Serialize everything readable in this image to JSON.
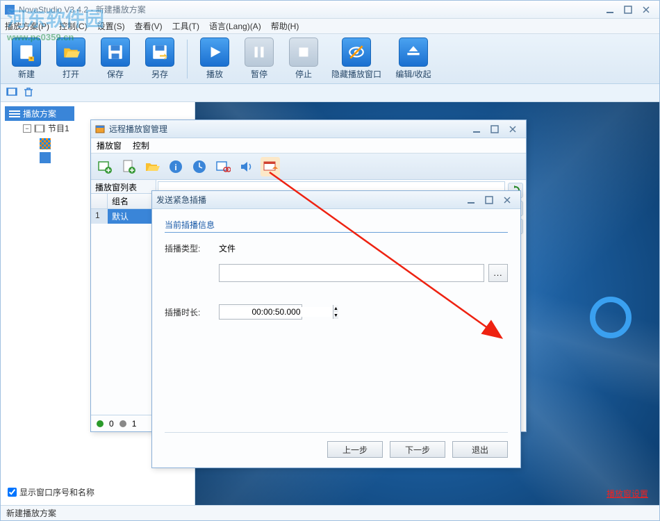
{
  "main": {
    "title": "NovaStudio V3.4.2 - 新建播放方案",
    "menu": [
      "播放方案(P)",
      "控制(C)",
      "设置(S)",
      "查看(V)",
      "工具(T)",
      "语言(Lang)(A)",
      "帮助(H)"
    ],
    "toolbar": {
      "new": "新建",
      "open": "打开",
      "save": "保存",
      "saveas": "另存",
      "play": "播放",
      "pause": "暂停",
      "stop": "停止",
      "hide": "隐藏播放窗口",
      "edit": "编辑/收起"
    },
    "tree": {
      "root": "播放方案",
      "child": "节目1"
    },
    "show_window_checkbox": "显示窗口序号和名称",
    "preview_link": "播放窗设置",
    "status": "新建播放方案"
  },
  "watermark": {
    "text": "河东软件园",
    "url": "www.pc0359.cn"
  },
  "remote": {
    "title": "远程播放窗管理",
    "menu": [
      "播放窗",
      "控制"
    ],
    "list_header": "播放窗列表",
    "col_num": "",
    "col_group": "组名",
    "row_num": "1",
    "row_group": "默认",
    "status_green": "0",
    "status_gray": "1"
  },
  "insert": {
    "title": "发送紧急插播",
    "section": "当前插播信息",
    "type_label": "插播类型:",
    "type_value": "文件",
    "file_value": "",
    "browse": "...",
    "duration_label": "插播时长:",
    "duration_value": "00:00:50.000",
    "prev": "上一步",
    "next": "下一步",
    "exit": "退出"
  }
}
